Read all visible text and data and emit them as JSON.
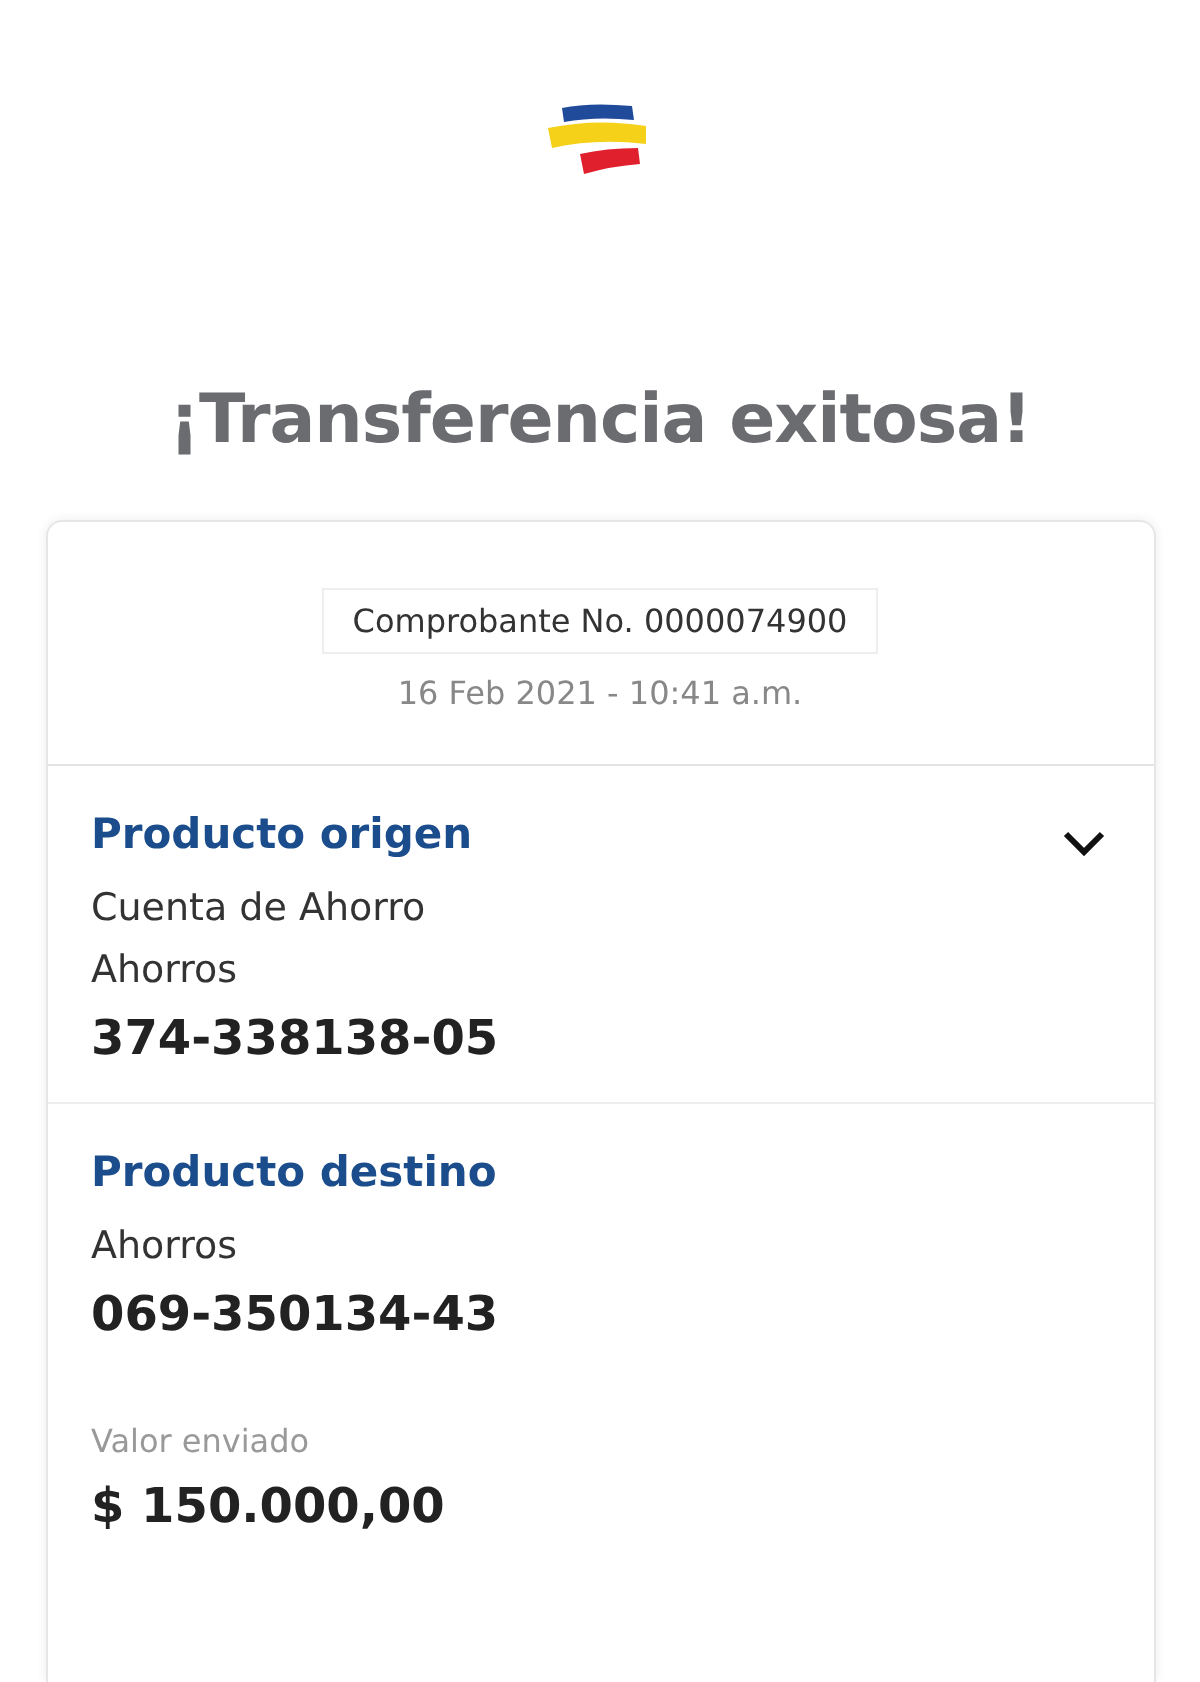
{
  "title": "¡Transferencia exitosa!",
  "receipt": {
    "number": "Comprobante No. 0000074900",
    "datetime": "16 Feb 2021 - 10:41 a.m."
  },
  "products": [
    {
      "heading": "Producto origen",
      "expanded": false,
      "lines": [
        {
          "kind": "text",
          "text": "Cuenta de Ahorro"
        },
        {
          "kind": "text",
          "text": "Ahorros"
        },
        {
          "kind": "account",
          "text": "374-338138-05"
        }
      ]
    },
    {
      "heading": "Producto destino",
      "lines": [
        {
          "kind": "text",
          "text": "Ahorros"
        },
        {
          "kind": "account",
          "text": "069-350134-43"
        }
      ]
    }
  ],
  "amount": {
    "label": "Valor enviado",
    "value": "$ 150.000,00"
  }
}
